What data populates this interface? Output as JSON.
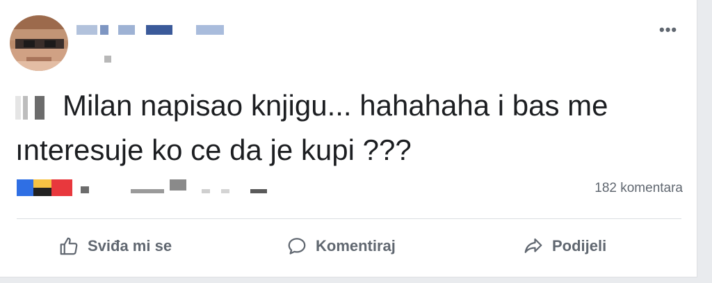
{
  "post": {
    "text": "Milan napisao knjigu... hahahaha i bas me ınteresuje ko ce da je kupi ???",
    "comment_count": "182 komentara"
  },
  "actions": {
    "like_label": "Sviđa mi se",
    "comment_label": "Komentiraj",
    "share_label": "Podijeli"
  },
  "icons": {
    "more": "more-options-icon",
    "like": "thumbs-up-icon",
    "comment": "speech-bubble-icon",
    "share": "share-arrow-icon"
  },
  "colors": {
    "text": "#1c1e21",
    "secondary": "#606770",
    "background": "#ffffff",
    "page": "#e9ebee"
  }
}
